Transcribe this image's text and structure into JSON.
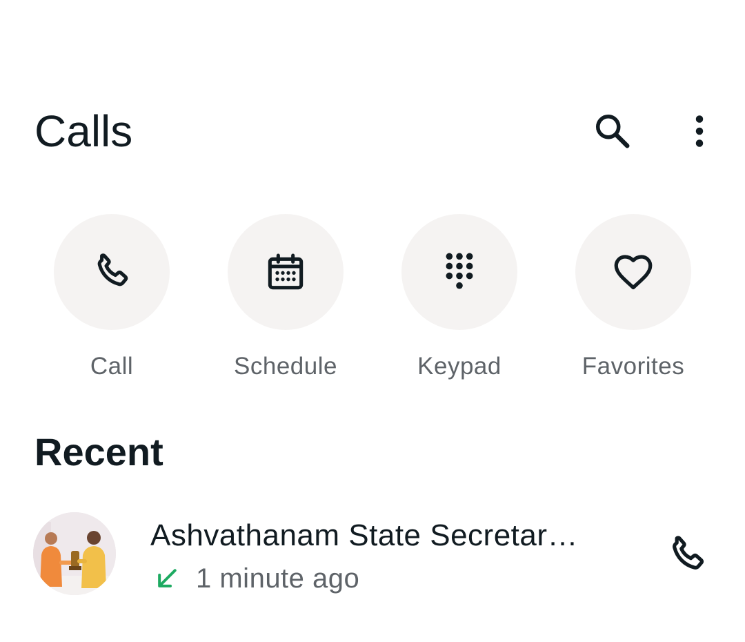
{
  "header": {
    "title": "Calls",
    "icons": [
      "search-icon",
      "more-vertical-icon"
    ]
  },
  "quick_actions": [
    {
      "label": "Call",
      "icon": "phone-icon"
    },
    {
      "label": "Schedule",
      "icon": "calendar-icon"
    },
    {
      "label": "Keypad",
      "icon": "dialpad-icon"
    },
    {
      "label": "Favorites",
      "icon": "heart-icon"
    }
  ],
  "recent": {
    "title": "Recent",
    "items": [
      {
        "name": "Ashvathanam State Secretar…",
        "time": "1 minute ago",
        "direction_icon": "incoming-call-arrow-icon",
        "direction_color": "#1daa61",
        "action_icon": "phone-icon"
      }
    ]
  },
  "colors": {
    "text_primary": "#111b21",
    "text_secondary": "#5e6368",
    "action_circle_bg": "#f5f3f2",
    "incoming_green": "#1daa61"
  }
}
